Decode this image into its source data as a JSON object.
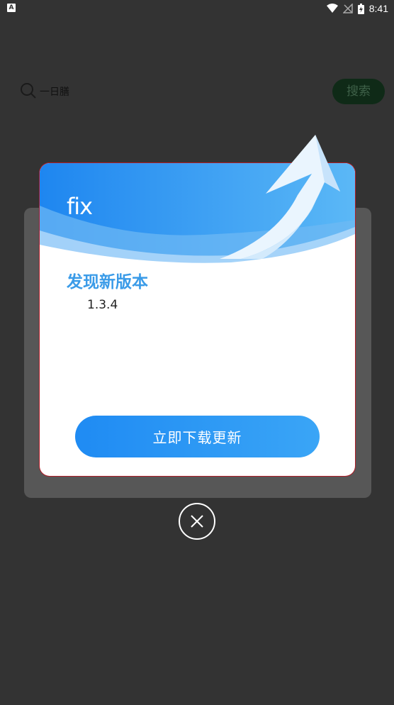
{
  "status_bar": {
    "time": "8:41",
    "app_icon_letter": "A"
  },
  "background": {
    "search_query": "一日膳",
    "search_button_label": "搜索"
  },
  "dialog": {
    "app_name": "fix",
    "title": "发现新版本",
    "version": "1.3.4",
    "update_button_label": "立即下载更新"
  },
  "colors": {
    "accent": "#2f95f4",
    "title": "#3a9be8",
    "backdrop": "#333333"
  },
  "icons": {
    "close": "close-icon",
    "arrow": "upward-arrow-icon",
    "search": "search-icon"
  }
}
